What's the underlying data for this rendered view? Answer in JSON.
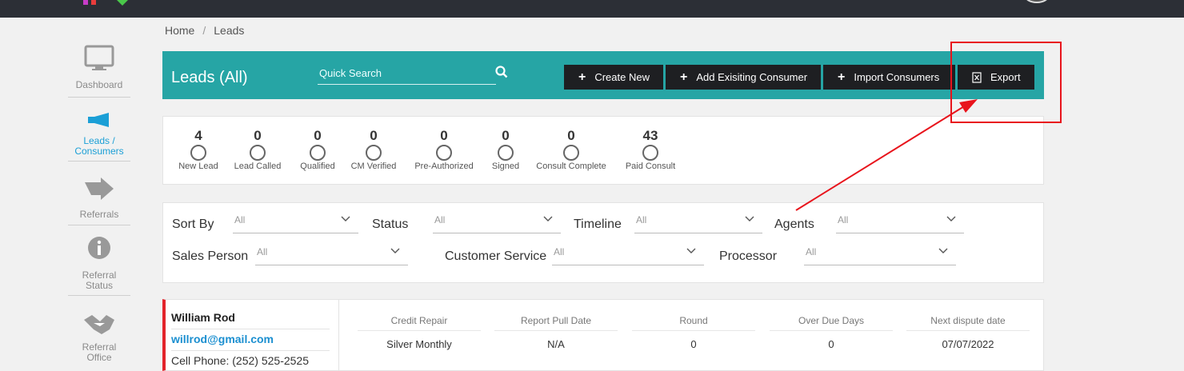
{
  "breadcrumb": {
    "home": "Home",
    "separator": "/",
    "current": "Leads"
  },
  "sidebar": {
    "items": [
      {
        "label": "Dashboard",
        "icon": "monitor-icon"
      },
      {
        "label": "Leads /\nConsumers",
        "label_line1": "Leads /",
        "label_line2": "Consumers",
        "icon": "megaphone-icon",
        "active": true
      },
      {
        "label": "Referrals",
        "icon": "arrow-right-icon"
      },
      {
        "label_line1": "Referral",
        "label_line2": "Status",
        "icon": "info-icon"
      },
      {
        "label_line1": "Referral",
        "label_line2": "Office",
        "icon": "handshake-icon"
      }
    ]
  },
  "header": {
    "title": "Leads (All)",
    "search_placeholder": "Quick Search",
    "buttons": {
      "create": "Create New",
      "add": "Add Exisiting Consumer",
      "import": "Import Consumers",
      "export": "Export"
    }
  },
  "stats": [
    {
      "value": "4",
      "label": "New Lead"
    },
    {
      "value": "0",
      "label": "Lead Called"
    },
    {
      "value": "0",
      "label": "Qualified"
    },
    {
      "value": "0",
      "label": "CM Verified"
    },
    {
      "value": "0",
      "label": "Pre-Authorized"
    },
    {
      "value": "0",
      "label": "Signed"
    },
    {
      "value": "0",
      "label": "Consult Complete"
    },
    {
      "value": "43",
      "label": "Paid Consult"
    }
  ],
  "filters": {
    "sort_by": {
      "label": "Sort By",
      "value": "All"
    },
    "status": {
      "label": "Status",
      "value": "All"
    },
    "timeline": {
      "label": "Timeline",
      "value": "All"
    },
    "agents": {
      "label": "Agents",
      "value": "All"
    },
    "sales_person": {
      "label": "Sales Person",
      "value": "All"
    },
    "customer_service": {
      "label": "Customer Service",
      "value": "All"
    },
    "processor": {
      "label": "Processor",
      "value": "All"
    }
  },
  "lead": {
    "name": "William Rod",
    "email": "willrod@gmail.com",
    "phone": "Cell Phone: (252) 525-2525",
    "columns": [
      {
        "header": "Credit Repair",
        "value": "Silver Monthly"
      },
      {
        "header": "Report Pull Date",
        "value": "N/A"
      },
      {
        "header": "Round",
        "value": "0"
      },
      {
        "header": "Over Due Days",
        "value": "0"
      },
      {
        "header": "Next dispute date",
        "value": "07/07/2022"
      }
    ]
  },
  "colors": {
    "header": "#26a5a5",
    "button": "#1e1f22",
    "active": "#1b9fd6",
    "accent_border": "#e3242b",
    "annotation": "#e8141c"
  }
}
